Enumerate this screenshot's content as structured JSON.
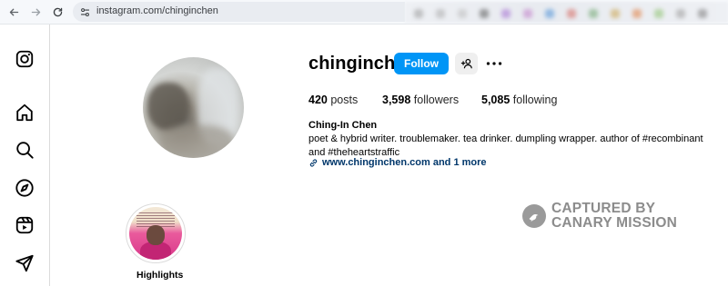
{
  "browser": {
    "url": "instagram.com/chinginchen",
    "back_icon": "arrow-left-icon",
    "forward_icon": "arrow-right-icon",
    "reload_icon": "reload-icon",
    "site_info_icon": "site-settings-icon"
  },
  "sidebar": {
    "items": [
      {
        "name": "instagram-logo-icon"
      },
      {
        "name": "home-icon"
      },
      {
        "name": "search-icon"
      },
      {
        "name": "explore-icon"
      },
      {
        "name": "reels-icon"
      },
      {
        "name": "direct-messages-icon"
      }
    ]
  },
  "profile": {
    "username": "chinginchen",
    "follow_label": "Follow",
    "stats": {
      "posts_count": "420",
      "posts_label": "posts",
      "followers_count": "3,598",
      "followers_label": "followers",
      "following_count": "5,085",
      "following_label": "following"
    },
    "full_name": "Ching-In Chen",
    "bio": "poet & hybrid writer. troublemaker. tea drinker. dumpling wrapper. author of #recombinant and #theheartstraffic",
    "link_text": "www.chinginchen.com and 1 more"
  },
  "highlights": [
    {
      "label": "Highlights"
    }
  ],
  "watermark": {
    "line1": "CAPTURED BY",
    "line2": "CANARY MISSION"
  },
  "colors": {
    "accent": "#0095f6",
    "link": "#00376b",
    "border": "#dbdbdb",
    "watermark": "#8c8c8c"
  }
}
